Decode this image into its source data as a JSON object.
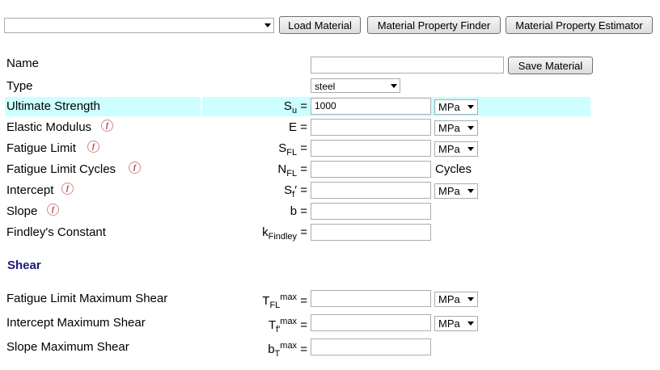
{
  "toolbar": {
    "material_select_value": "",
    "load_label": "Load Material",
    "finder_label": "Material Property Finder",
    "estimator_label": "Material Property Estimator"
  },
  "form": {
    "name_label": "Name",
    "name_value": "",
    "save_label": "Save Material",
    "type_label": "Type",
    "type_value": "steel",
    "rows": [
      {
        "label": "Ultimate Strength",
        "sym": "S",
        "sub": "u",
        "sup": "",
        "value": "1000",
        "unit": "MPa"
      },
      {
        "label": "Elastic Modulus",
        "sym": "E",
        "sub": "",
        "sup": "",
        "value": "",
        "unit": "MPa"
      },
      {
        "label": "Fatigue Limit",
        "sym": "S",
        "sub": "FL",
        "sup": "",
        "value": "",
        "unit": "MPa"
      },
      {
        "label": "Fatigue Limit Cycles",
        "sym": "N",
        "sub": "FL",
        "sup": "",
        "value": "",
        "unit": "Cycles"
      },
      {
        "label": "Intercept",
        "sym": "S",
        "sub": "f",
        "sup": "′",
        "value": "",
        "unit": "MPa"
      },
      {
        "label": "Slope",
        "sym": "b",
        "sub": "",
        "sup": "",
        "value": "",
        "unit": ""
      },
      {
        "label": "Findley's Constant",
        "sym": "k",
        "sub": "Findley",
        "sup": "",
        "value": "",
        "unit": ""
      }
    ],
    "equals": "="
  },
  "shear": {
    "heading": "Shear",
    "rows": [
      {
        "label": "Fatigue Limit Maximum Shear",
        "sym": "T",
        "sub": "FL",
        "sup": "max",
        "value": "",
        "unit": "MPa"
      },
      {
        "label": "Intercept Maximum Shear",
        "sym": "T",
        "sub": "f′",
        "sup": "max",
        "value": "",
        "unit": "MPa"
      },
      {
        "label": "Slope Maximum Shear",
        "sym": "b",
        "sub": "T",
        "sup": "max",
        "value": "",
        "unit": ""
      }
    ]
  },
  "icons": {
    "formula": "f"
  },
  "colors": {
    "highlight": "#ccffff",
    "shear_heading": "#1a1a7a"
  }
}
